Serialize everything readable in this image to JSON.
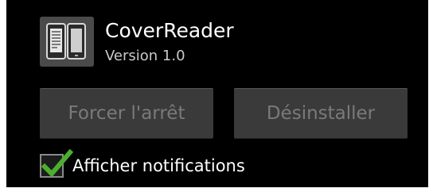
{
  "app": {
    "name": "CoverReader",
    "version": "Version 1.0",
    "icon": "book-reader-icon"
  },
  "actions": {
    "force_stop_label": "Forcer l'arrêt",
    "uninstall_label": "Désinstaller"
  },
  "notifications": {
    "label": "Afficher notifications",
    "checked": true
  },
  "colors": {
    "background": "#000000",
    "button": "#3a3a3a",
    "button_text_disabled": "#7a7a7a",
    "check_accent": "#4caf2e"
  }
}
